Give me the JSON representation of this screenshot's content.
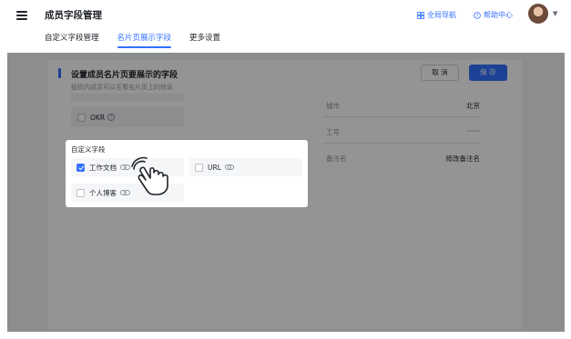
{
  "header": {
    "title": "成员字段管理",
    "global_nav": "全局导航",
    "help_center": "帮助中心"
  },
  "tabs": [
    {
      "label": "自定义字段管理",
      "active": false
    },
    {
      "label": "名片页展示字段",
      "active": true
    },
    {
      "label": "更多设置",
      "active": false
    }
  ],
  "section": {
    "title": "设置成员名片页要展示的字段",
    "subtitle": "组织内成员可以互看名片页上的信息"
  },
  "buttons": {
    "cancel": "取 消",
    "save": "保 存"
  },
  "fields": {
    "okr": {
      "label": "OKR",
      "checked": false
    }
  },
  "preview": [
    {
      "label": "城市",
      "value": "北京"
    },
    {
      "label": "工号",
      "value": "······"
    },
    {
      "label": "备注名",
      "value": "修改备注名"
    }
  ],
  "custom_fields": {
    "title": "自定义字段",
    "options": [
      {
        "label": "工作文档",
        "checked": true
      },
      {
        "label": "URL",
        "checked": false
      },
      {
        "label": "个人博客",
        "checked": false
      }
    ]
  },
  "colors": {
    "accent": "#3370ff",
    "text": "#1f2329",
    "muted": "#8f959e"
  }
}
